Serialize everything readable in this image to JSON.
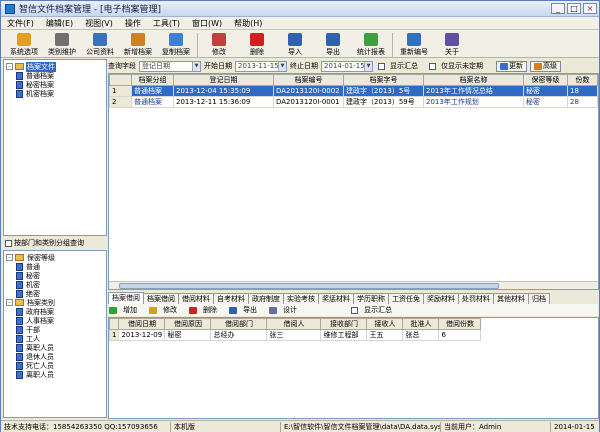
{
  "window": {
    "title": "智信文件档案管理 - [电子档案管理]"
  },
  "menu": [
    "文件(F)",
    "编辑(E)",
    "视图(V)",
    "操作",
    "工具(T)",
    "窗口(W)",
    "帮助(H)"
  ],
  "toolbar": [
    {
      "label": "系统选项",
      "icon": "settings-key-icon",
      "color": "#e0a020"
    },
    {
      "label": "类别维护",
      "icon": "wrench-icon",
      "color": "#707070"
    },
    {
      "label": "公司资料",
      "icon": "company-icon",
      "color": "#3a70c0"
    },
    {
      "label": "新增档案",
      "icon": "add-archive-icon",
      "color": "#d08020"
    },
    {
      "label": "复制档案",
      "icon": "copy-archive-icon",
      "color": "#4080d0"
    },
    {
      "label": "修改",
      "icon": "edit-pencil-icon",
      "color": "#c04040"
    },
    {
      "label": "删除",
      "icon": "delete-x-icon",
      "color": "#d02020"
    },
    {
      "label": "导入",
      "icon": "import-icon",
      "color": "#3060b0"
    },
    {
      "label": "导出",
      "icon": "export-icon",
      "color": "#3060b0"
    },
    {
      "label": "统计报表",
      "icon": "chart-report-icon",
      "color": "#40a040"
    },
    {
      "label": "重新编号",
      "icon": "renumber-icon",
      "color": "#3070c0"
    },
    {
      "label": "关于",
      "icon": "help-question-icon",
      "color": "#6050a0"
    }
  ],
  "top_tree": [
    {
      "label": "档案文件",
      "level": 0,
      "type": "folder",
      "selected": true
    },
    {
      "label": "普通档案",
      "level": 1,
      "type": "doc"
    },
    {
      "label": "秘密档案",
      "level": 1,
      "type": "doc"
    },
    {
      "label": "机密档案",
      "level": 1,
      "type": "doc"
    }
  ],
  "mid_bar": {
    "label": "按部门和类别分组查询"
  },
  "bottom_tree": [
    {
      "label": "保密等级",
      "level": 0,
      "type": "folder"
    },
    {
      "label": "普通",
      "level": 1,
      "type": "doc"
    },
    {
      "label": "秘密",
      "level": 1,
      "type": "doc"
    },
    {
      "label": "机密",
      "level": 1,
      "type": "doc"
    },
    {
      "label": "绝密",
      "level": 1,
      "type": "doc"
    },
    {
      "label": "档案类别",
      "level": 0,
      "type": "folder"
    },
    {
      "label": "政府档案",
      "level": 1,
      "type": "doc"
    },
    {
      "label": "人事档案",
      "level": 1,
      "type": "doc"
    },
    {
      "label": "干部",
      "level": 1,
      "type": "doc"
    },
    {
      "label": "工人",
      "level": 1,
      "type": "doc"
    },
    {
      "label": "离职人员",
      "level": 1,
      "type": "doc"
    },
    {
      "label": "退休人员",
      "level": 1,
      "type": "doc"
    },
    {
      "label": "死亡人员",
      "level": 1,
      "type": "doc"
    },
    {
      "label": "离职人员",
      "level": 1,
      "type": "doc"
    }
  ],
  "filter": {
    "field_label": "查询字段",
    "field_value": "登记日期",
    "start_label": "开始日期",
    "start_value": "2013-11-15",
    "end_label": "终止日期",
    "end_value": "2014-01-15",
    "show_summary": "显示汇总",
    "show_unassigned": "仅显示未定期",
    "refresh": "更新",
    "advanced": "高级"
  },
  "main_table": {
    "columns": [
      "档案分组",
      "登记日期",
      "档案编号",
      "档案字号",
      "档案名称",
      "保密等级",
      "份数"
    ],
    "rows": [
      [
        "普通档案",
        "2013-12-04 15:35:09",
        "DA2013120I-0002",
        "建政字（2013）5号",
        "2013年工作情况总结",
        "秘密",
        "18"
      ],
      [
        "普通档案",
        "2013-12-11 15:36:09",
        "DA2013120I-0001",
        "建政字（2013）59号",
        "2013年工作规划",
        "秘密",
        "28"
      ]
    ]
  },
  "tabs": [
    "档案借阅",
    "档案借阅",
    "借阅材料",
    "自考材料",
    "政府制度",
    "实验考核",
    "奖惩材料",
    "学历职称",
    "工资任免",
    "奖励材料",
    "处罚材料",
    "其他材料",
    "归档"
  ],
  "sub_toolbar": {
    "add": "增加",
    "edit": "修改",
    "delete": "删除",
    "export": "导出",
    "design": "设计",
    "show_summary": "显示汇总"
  },
  "sub_table": {
    "columns": [
      "借阅日期",
      "借阅原因",
      "借阅部门",
      "借阅人",
      "接收部门",
      "接收人",
      "批准人",
      "借阅份数"
    ],
    "rows": [
      [
        "2013-12-09",
        "秘密",
        "总经办",
        "张三",
        "维修工程部",
        "王五",
        "张总",
        "6"
      ]
    ]
  },
  "status": {
    "support": "技术支持电话：15854263350 QQ:157093656",
    "machine": "本机版",
    "path": "E:\\智信软件\\智信文件档案管理\\data\\DA.data.sys",
    "user": "当前用户：Admin",
    "date": "2014-01-15"
  }
}
